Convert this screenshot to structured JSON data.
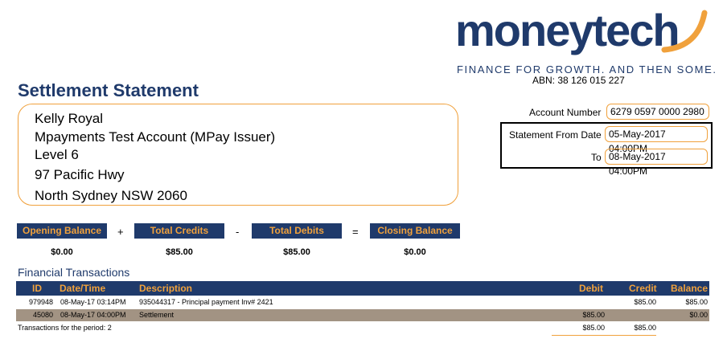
{
  "logo": {
    "word": "moneytech",
    "tagline": "FINANCE FOR GROWTH. AND THEN SOME."
  },
  "abn": "ABN: 38 126 015 227",
  "title": "Settlement Statement",
  "address": {
    "line1": "Kelly Royal",
    "line2": "Mpayments Test Account (MPay Issuer)",
    "line3": "Level 6",
    "line4": "97 Pacific Hwy",
    "line5": "North Sydney NSW 2060"
  },
  "account": {
    "number_label": "Account Number",
    "number": "6279 0597 0000 2980",
    "from_label": "Statement From Date",
    "from": "05-May-2017 04:00PM",
    "to_label": "To",
    "to": "08-May-2017 04:00PM"
  },
  "summary": {
    "opening_label": "Opening Balance",
    "opening": "$0.00",
    "plus": "+",
    "credits_label": "Total Credits",
    "credits": "$85.00",
    "minus": "-",
    "debits_label": "Total Debits",
    "debits": "$85.00",
    "equals": "=",
    "closing_label": "Closing Balance",
    "closing": "$0.00"
  },
  "transactions": {
    "title": "Financial Transactions",
    "columns": {
      "id": "ID",
      "datetime": "Date/Time",
      "description": "Description",
      "debit": "Debit",
      "credit": "Credit",
      "balance": "Balance"
    },
    "rows": [
      {
        "id": "979948",
        "datetime": "08-May-17 03:14PM",
        "description": "935044317 - Principal payment Inv# 2421",
        "debit": "",
        "credit": "$85.00",
        "balance": "$85.00"
      },
      {
        "id": "45080",
        "datetime": "08-May-17 04:00PM",
        "description": "Settlement",
        "debit": "$85.00",
        "credit": "",
        "balance": "$0.00"
      }
    ],
    "footer_label": "Transactions for the period: 2",
    "footer_debit": "$85.00",
    "footer_credit": "$85.00"
  },
  "colors": {
    "navy": "#1f3a6b",
    "orange": "#f0a13c",
    "settlement_row": "#a29383"
  }
}
